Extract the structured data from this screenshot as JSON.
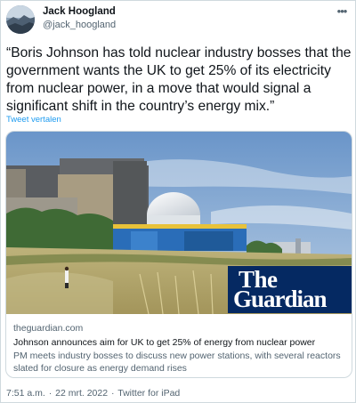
{
  "author": {
    "name": "Jack Hoogland",
    "handle": "@jack_hoogland"
  },
  "tweet": {
    "text": "“Boris Johnson has told nuclear industry bosses that the government wants the UK to get 25% of its electricity from nuclear power, in a move that would signal a significant shift in the country’s energy mix.”",
    "translate_label": "Tweet vertalen"
  },
  "card": {
    "logo_line1": "The",
    "logo_line2": "Guardian",
    "domain": "theguardian.com",
    "title": "Johnson announces aim for UK to get 25% of energy from nuclear power",
    "description": "PM meets industry bosses to discuss new power stations, with several reactors slated for closure as energy demand rises"
  },
  "meta": {
    "time": "7:51 a.m.",
    "date": "22 mrt. 2022",
    "source": "Twitter for iPad",
    "separator": "·"
  },
  "icons": {
    "more": "more-horizontal-icon"
  },
  "colors": {
    "link": "#1d9bf0",
    "secondary_text": "#536471",
    "guardian_blue": "#052962",
    "border": "#cfd9de"
  }
}
